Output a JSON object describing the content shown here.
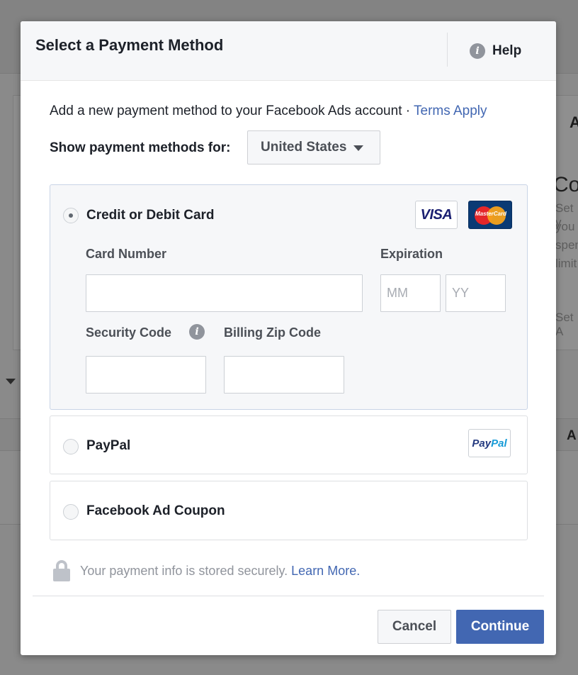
{
  "background": {
    "fragments": [
      "A",
      "Co",
      "Set y",
      "you",
      "spen",
      "limit",
      "Set A",
      "A"
    ]
  },
  "dialog": {
    "title": "Select a Payment Method",
    "help_label": "Help",
    "help_icon": "info-icon",
    "intro_text": "Add a new payment method to your Facebook Ads account · ",
    "terms_link": "Terms Apply",
    "show_for_label": "Show payment methods for:",
    "country": "United States",
    "options": {
      "card": {
        "label": "Credit or Debit Card",
        "selected": true,
        "logos": {
          "visa": "VISA",
          "mastercard": "MasterCard"
        },
        "card_number_label": "Card Number",
        "card_number_value": "",
        "expiration_label": "Expiration",
        "month_placeholder": "MM",
        "year_placeholder": "YY",
        "security_code_label": "Security Code",
        "billing_zip_label": "Billing Zip Code"
      },
      "paypal": {
        "label": "PayPal",
        "selected": false,
        "logo_part1": "Pay",
        "logo_part2": "Pal"
      },
      "coupon": {
        "label": "Facebook Ad Coupon",
        "selected": false
      }
    },
    "secure_text": "Your payment info is stored securely. ",
    "learn_more": "Learn More.",
    "cancel_label": "Cancel",
    "continue_label": "Continue"
  },
  "colors": {
    "accent": "#4267b2",
    "text": "#1d2129",
    "muted": "#90949c"
  }
}
